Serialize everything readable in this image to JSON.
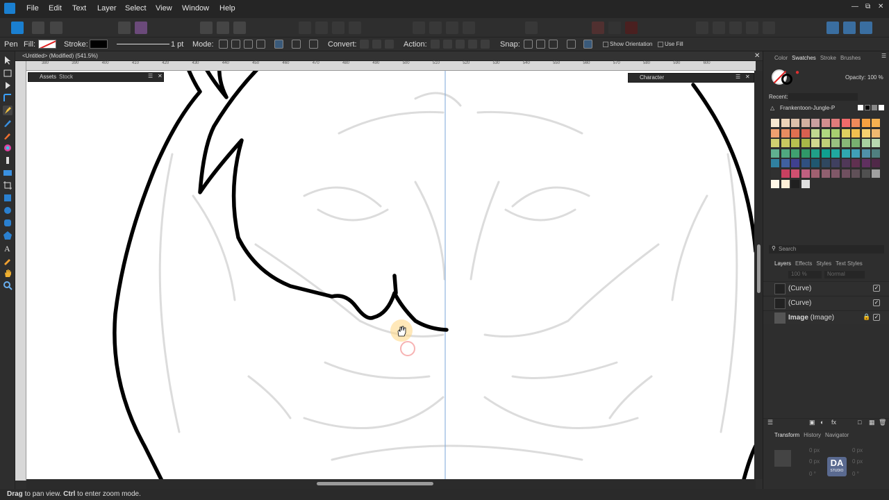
{
  "menu": {
    "items": [
      "File",
      "Edit",
      "Text",
      "Layer",
      "Select",
      "View",
      "Window",
      "Help"
    ]
  },
  "context": {
    "tool": "Pen",
    "fill_label": "Fill:",
    "stroke_label": "Stroke:",
    "stroke_width": "1 pt",
    "mode_label": "Mode:",
    "convert_label": "Convert:",
    "action_label": "Action:",
    "snap_label": "Snap:",
    "show_orientation": "Show Orientation",
    "use_fill": "Use Fill"
  },
  "document": {
    "title": "<Untitled> (Modified) (541.5%)"
  },
  "ruler": {
    "ticks": [
      "380",
      "390",
      "400",
      "410",
      "420",
      "430",
      "440",
      "450",
      "460",
      "470",
      "480",
      "490",
      "500",
      "510",
      "520",
      "530",
      "540",
      "550",
      "560",
      "570",
      "580",
      "590",
      "600"
    ]
  },
  "panels": {
    "assets_tab": "Assets",
    "stock_tab": "Stock",
    "character_tab": "Character"
  },
  "right": {
    "color_tabs": [
      "Color",
      "Swatches",
      "Stroke",
      "Brushes"
    ],
    "opacity_label": "Opacity:",
    "opacity_value": "100 %",
    "recent_label": "Recent:",
    "palette_name": "Frankentoon-Jungle-P",
    "search_placeholder": "Search",
    "layer_tabs": [
      "Layers",
      "Effects",
      "Styles",
      "Text Styles"
    ],
    "layer_opacity": "100 %",
    "blend_mode": "Normal",
    "layers": [
      {
        "name": "(Curve)",
        "bold": ""
      },
      {
        "name": "(Curve)",
        "bold": ""
      },
      {
        "name": "(Image)",
        "bold": "Image"
      }
    ],
    "bottom_tabs": [
      "Transform",
      "History",
      "Navigator"
    ],
    "transform": {
      "x": "0 px",
      "y": "0 px",
      "w": "0 px",
      "h": "0 px",
      "r": "0 °",
      "s": "0 °"
    },
    "watermark": "DA",
    "watermark_sub": "STUDIO"
  },
  "swatches": {
    "rows": [
      [
        "#f5e6d0",
        "#ecd3b8",
        "#dcc0aa",
        "#d2b0a0",
        "#c9a0a0",
        "#d28e8e",
        "#e07b7b",
        "#f06a6a",
        "#f08a5a",
        "#f5a040",
        "#f5b050"
      ],
      [
        "#f0a070",
        "#e88c60",
        "#e07050",
        "#d86050",
        "#c0d890",
        "#b0d880",
        "#a8cf70",
        "#e0d060",
        "#f0c050",
        "#f5d070",
        "#f0b870"
      ],
      [
        "#d0d070",
        "#c8c860",
        "#b8c050",
        "#a8b848",
        "#d0d890",
        "#c0d078",
        "#98c080",
        "#88b878",
        "#78b070",
        "#a8d0a0",
        "#b8d8b0"
      ],
      [
        "#60b090",
        "#50a880",
        "#40a070",
        "#309868",
        "#20a088",
        "#10a090",
        "#20a8a0",
        "#30a8b0",
        "#40a0b8",
        "#5090a8",
        "#508080"
      ],
      [
        "#3080a0",
        "#4060a0",
        "#404090",
        "#305080",
        "#205870",
        "#304860",
        "#404060",
        "#503858",
        "#603050",
        "#603060",
        "#502848"
      ],
      [
        "#303030",
        "#c84060",
        "#d05070",
        "#c06080",
        "#a06070",
        "#906070",
        "#805868",
        "#705060",
        "#605058",
        "#505050",
        "#a0a0a0"
      ],
      [
        "#fff8e8",
        "#fff0d8",
        "#202020",
        "#e0e0e0"
      ]
    ]
  },
  "status": {
    "bold1": "Drag",
    "text1": " to pan view. ",
    "bold2": "Ctrl",
    "text2": " to enter zoom mode."
  }
}
